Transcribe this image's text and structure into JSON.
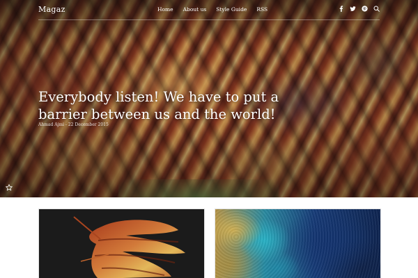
{
  "site": {
    "logo": "Magaz"
  },
  "nav": {
    "items": [
      {
        "label": "Home"
      },
      {
        "label": "About us"
      },
      {
        "label": "Style Guide"
      },
      {
        "label": "RSS"
      }
    ],
    "social_icons": [
      "facebook-icon",
      "twitter-icon",
      "pinterest-icon",
      "search-icon"
    ]
  },
  "hero": {
    "title": "Everybody listen! We have to put a barrier between us and the world!",
    "meta": "Ahmad Ajmi - 22 December 2015",
    "favorite_icon": "star-outline-icon"
  },
  "cards": [
    {
      "image": "dried-leaf-on-black"
    },
    {
      "image": "aerial-coastline-gold-blue"
    }
  ],
  "colors": {
    "nav_text": "#ffffff",
    "page_bg": "#ffffff",
    "card_left_bg": "#1b1b1b"
  }
}
